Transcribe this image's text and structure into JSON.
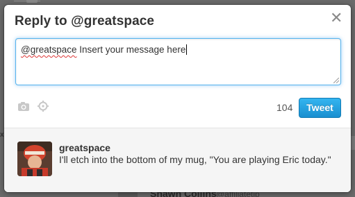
{
  "background": {
    "left_glyph": "x",
    "list_user_name": "Shawn Collins",
    "list_user_handle": "@affiliatetip"
  },
  "dialog": {
    "title": "Reply to @greatspace",
    "close_glyph": "✕",
    "composer": {
      "mention": "@greatspace",
      "text": " Insert your message here"
    },
    "toolbar": {
      "icons": [
        "camera-icon",
        "location-icon"
      ],
      "char_count": "104",
      "tweet_label": "Tweet"
    },
    "original_tweet": {
      "user": "greatspace",
      "text": "I'll etch into the bottom of my mug, \"You are playing Eric today.\""
    }
  },
  "colors": {
    "tweet_button": "#1a8fd0",
    "focus_border": "#56b4ef",
    "context_bg": "#f5f5f5"
  }
}
